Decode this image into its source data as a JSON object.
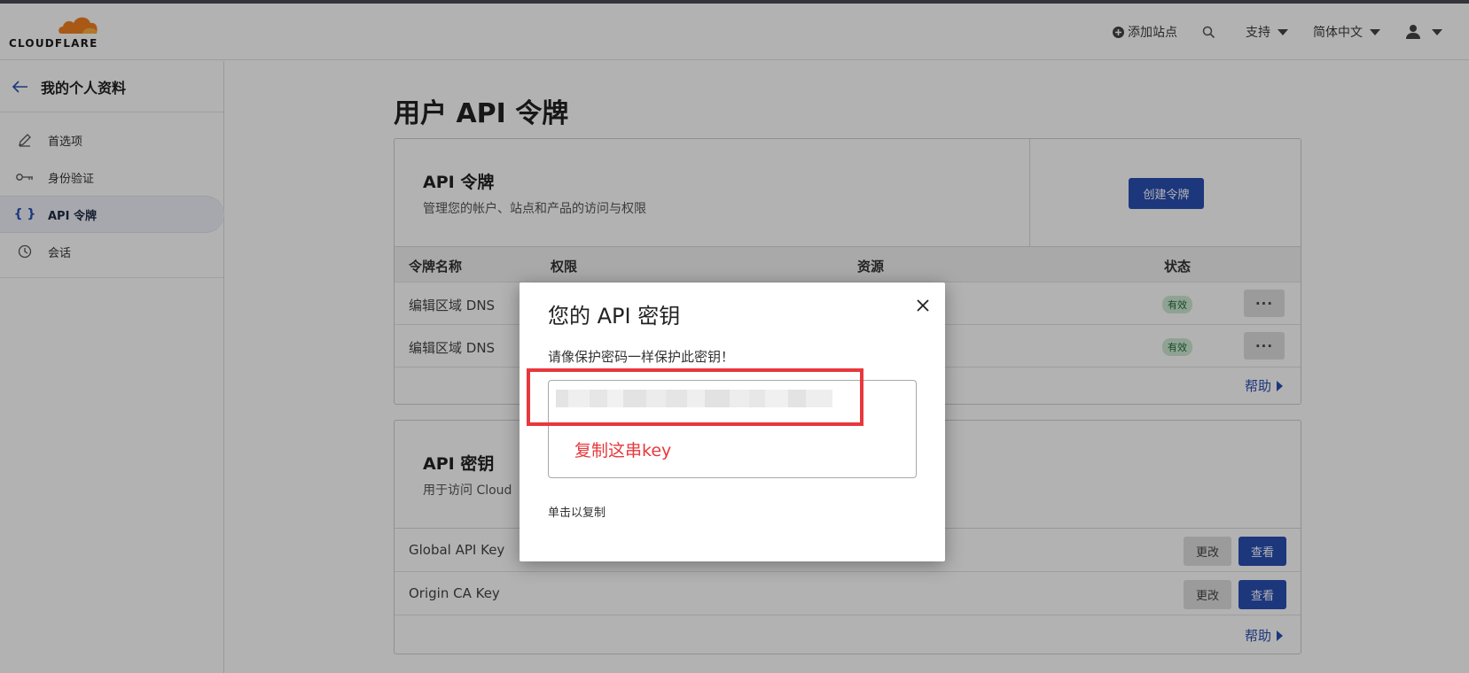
{
  "brand": {
    "logo_text": "CLOUDFLARE",
    "color": "#f38020"
  },
  "topnav": {
    "add_site": "添加站点",
    "support": "支持",
    "language": "简体中文"
  },
  "sidebar": {
    "back_title": "我的个人资料",
    "items": [
      {
        "label": "首选项",
        "icon": "pencil-icon"
      },
      {
        "label": "身份验证",
        "icon": "key-icon"
      },
      {
        "label": "API 令牌",
        "icon": "braces-icon",
        "active": true
      },
      {
        "label": "会话",
        "icon": "clock-icon"
      }
    ]
  },
  "main": {
    "title": "用户 API 令牌",
    "tokens_card": {
      "title": "API 令牌",
      "desc": "管理您的帐户、站点和产品的访问与权限",
      "create_button": "创建令牌",
      "columns": [
        "令牌名称",
        "权限",
        "资源",
        "状态"
      ],
      "rows": [
        {
          "name": "编辑区域 DNS",
          "status": "有效"
        },
        {
          "name": "编辑区域 DNS",
          "status": "有效"
        }
      ],
      "more_label": "···",
      "help": "帮助"
    },
    "keys_card": {
      "title": "API 密钥",
      "desc": "用于访问 Cloud",
      "rows": [
        {
          "name": "Global API Key",
          "change": "更改",
          "view": "查看"
        },
        {
          "name": "Origin CA Key",
          "change": "更改",
          "view": "查看"
        }
      ],
      "help": "帮助"
    }
  },
  "modal": {
    "title": "您的 API 密钥",
    "warning": "请像保护密码一样保护此密钥！",
    "annotation": "复制这串key",
    "copy_hint": "单击以复制"
  },
  "colors": {
    "primary": "#2a4fb4",
    "annotation_red": "#e8383d",
    "status_green": "#cfe9d4"
  }
}
